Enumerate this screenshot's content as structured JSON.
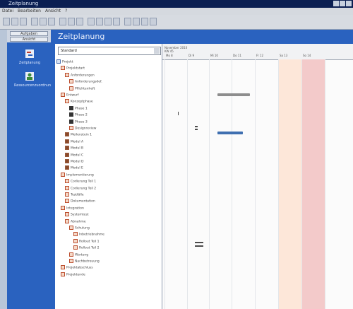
{
  "window": {
    "title": "Zeitplanung"
  },
  "menu": [
    "Datei",
    "Bearbeiten",
    "Ansicht",
    "?"
  ],
  "nav": {
    "tabs": [
      "Aufgaben",
      "Ansicht"
    ],
    "items": [
      "Zeitplanung",
      "Ressourcenzuordnung"
    ]
  },
  "header": {
    "title": "Zeitplanung"
  },
  "tree": {
    "filter": "Standard",
    "rows": [
      "Projekt",
      "Projektstart",
      "Anforderungen",
      "Anforderungsdef.",
      "Pflichtenheft",
      "Entwurf",
      "Konzeptphase",
      "Phase 1",
      "Phase 2",
      "Phase 3",
      "Designreview",
      "Meilenstein 1",
      "Modul A",
      "Modul B",
      "Modul C",
      "Modul D",
      "Modul E",
      "Implementierung",
      "Codierung Teil 1",
      "Codierung Teil 2",
      "Testfälle",
      "Dokumentation",
      "Integration",
      "Systemtest",
      "Abnahme",
      "Schulung",
      "Inbetriebnahme",
      "Rollout Teil 1",
      "Rollout Teil 2",
      "Wartung",
      "Nachbetreuung",
      "Projektabschluss",
      "Projektende"
    ]
  },
  "gantt": {
    "header_line1": "November 2010",
    "header_line2": "KW 45",
    "ticks": [
      "Mo 8",
      "Di 9",
      "Mi 10",
      "Do 11",
      "Fr 12",
      "Sa 13",
      "So 14"
    ],
    "colors": {
      "bar_grey": "#8d8d8d",
      "bar_blue": "#3f6fb0",
      "weekend_sat": "#fde7d9",
      "weekend_sun": "#f3caca"
    }
  }
}
